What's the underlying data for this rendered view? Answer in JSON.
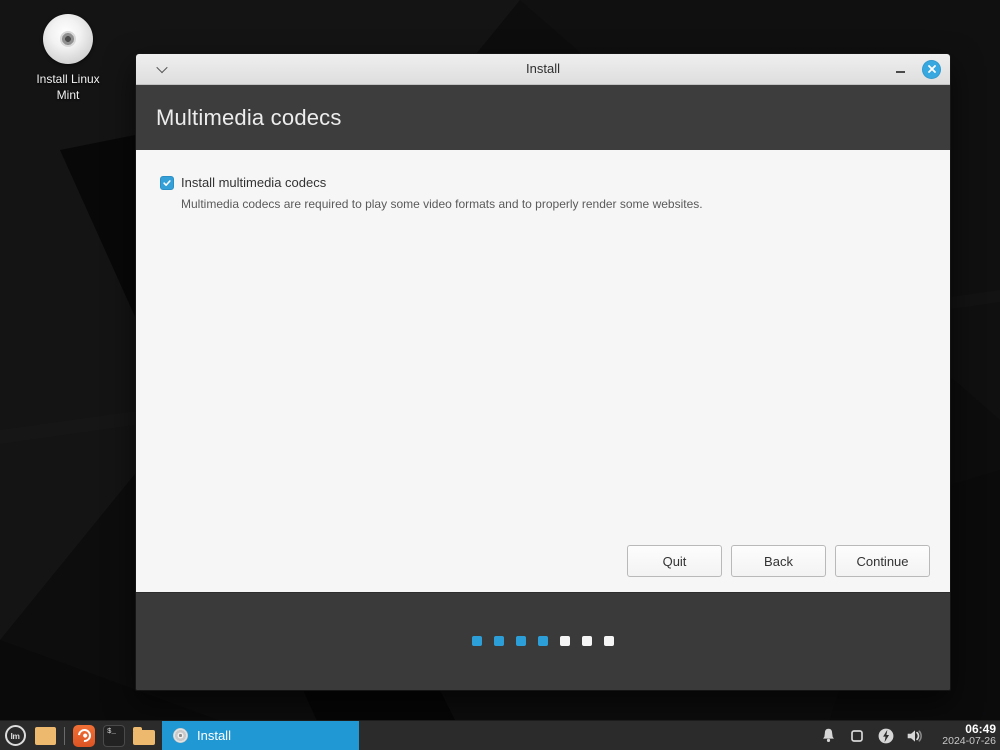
{
  "desktop": {
    "install_icon_label": "Install Linux Mint"
  },
  "window": {
    "title": "Install",
    "page_title": "Multimedia codecs",
    "codecs_checkbox": {
      "label": "Install multimedia codecs",
      "checked": true
    },
    "description": "Multimedia codecs are required to play some video formats and to properly render some websites.",
    "buttons": {
      "quit": "Quit",
      "back": "Back",
      "continue": "Continue"
    },
    "progress_dots": {
      "total": 7,
      "active": 4
    }
  },
  "taskbar": {
    "launcher_icons": [
      "mint-menu",
      "show-desktop",
      "firefox",
      "terminal",
      "file-manager"
    ],
    "tray_icons": [
      "notifications",
      "clipboard",
      "power",
      "volume"
    ],
    "active_task": {
      "label": "Install",
      "icon": "cd-disc-icon"
    },
    "terminal_glyph": "$_",
    "mint_logo_text": "lm",
    "clock": {
      "time": "06:49",
      "date": "2024-07-26"
    }
  },
  "colors": {
    "accent_blue": "#2d9fd8",
    "active_task_blue": "#2098d4",
    "close_button_blue": "#38a8e0",
    "header_dark": "#3d3d3d",
    "footer_dark": "#3a3a3a",
    "taskbar_dark": "#2b2b2b",
    "content_light": "#f6f6f6"
  }
}
